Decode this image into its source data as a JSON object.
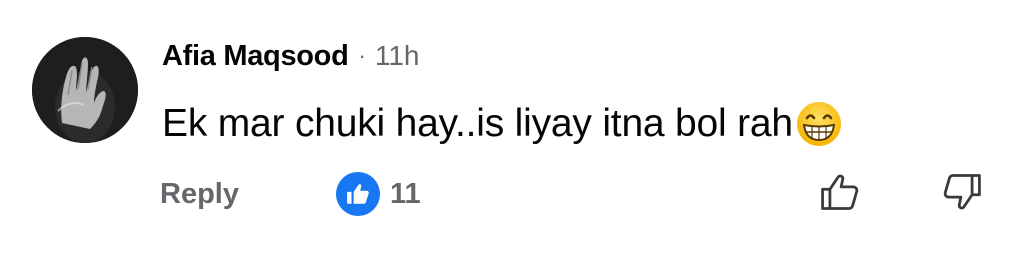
{
  "comment": {
    "author": "Afia Maqsood",
    "separator": "·",
    "time": "11h",
    "text": "Ek mar chuki hay..is liyay itna bol rah",
    "emoji": "grinning-face-emoji"
  },
  "actions": {
    "reply_label": "Reply",
    "reaction_count": "11",
    "reaction_icon": "thumbs-up-icon",
    "like_icon": "thumbs-up-outline-icon",
    "dislike_icon": "thumbs-down-outline-icon"
  },
  "colors": {
    "primary_text": "#050505",
    "secondary_text": "#65676b",
    "like_blue": "#1877f2"
  }
}
